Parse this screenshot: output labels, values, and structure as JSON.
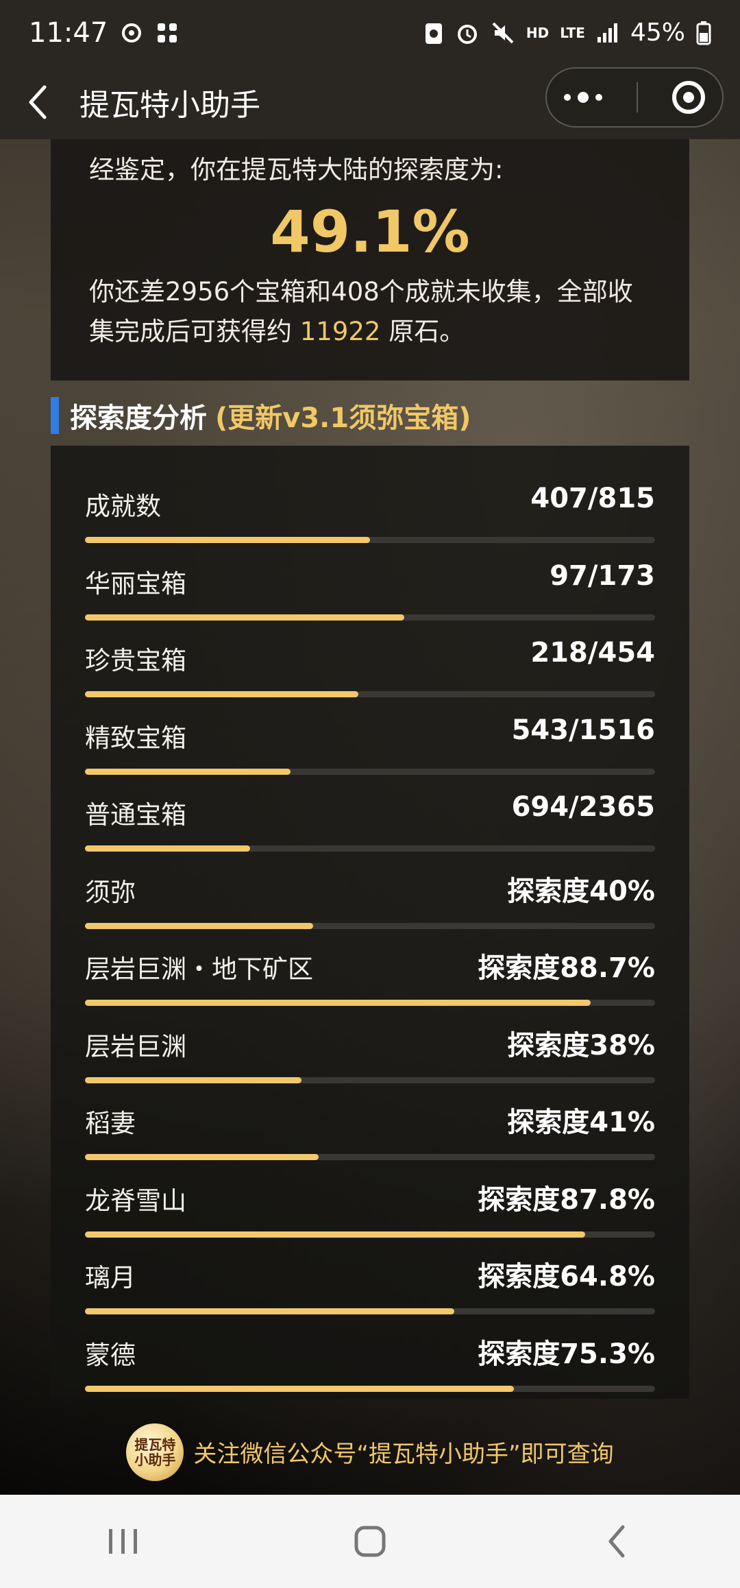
{
  "status_bar": {
    "time": "11:47",
    "battery": "45%",
    "icons": [
      "sync-icon",
      "grid-icon",
      "recycle-icon",
      "alarm-icon",
      "mute-icon",
      "hd-voice-icon",
      "lte-icon",
      "signal-icon",
      "battery-icon"
    ],
    "hd_label": "HD",
    "lte_label": "LTE"
  },
  "nav": {
    "title": "提瓦特小助手"
  },
  "summary": {
    "lead": "经鉴定，你在提瓦特大陆的探索度为:",
    "percent": "49.1%",
    "desc_prefix": "你还差2956个宝箱和408个成就未收集，全部收集完成后可获得约 ",
    "gems": "11922",
    "desc_suffix": " 原石。"
  },
  "section": {
    "title": "探索度分析",
    "subtitle": "(更新v3.1须弥宝箱)"
  },
  "stats": [
    {
      "label": "成就数",
      "value": "407/815",
      "progress": 0.5
    },
    {
      "label": "华丽宝箱",
      "value": "97/173",
      "progress": 0.56
    },
    {
      "label": "珍贵宝箱",
      "value": "218/454",
      "progress": 0.48
    },
    {
      "label": "精致宝箱",
      "value": "543/1516",
      "progress": 0.36
    },
    {
      "label": "普通宝箱",
      "value": "694/2365",
      "progress": 0.29
    },
    {
      "label": "须弥",
      "value": "探索度40%",
      "progress": 0.4
    },
    {
      "label": "层岩巨渊・地下矿区",
      "value": "探索度88.7%",
      "progress": 0.887
    },
    {
      "label": "层岩巨渊",
      "value": "探索度38%",
      "progress": 0.38
    },
    {
      "label": "稻妻",
      "value": "探索度41%",
      "progress": 0.41
    },
    {
      "label": "龙脊雪山",
      "value": "探索度87.8%",
      "progress": 0.878
    },
    {
      "label": "璃月",
      "value": "探索度64.8%",
      "progress": 0.648
    },
    {
      "label": "蒙德",
      "value": "探索度75.3%",
      "progress": 0.753
    }
  ],
  "footer": {
    "logo_text": "提瓦特小助手",
    "text": "关注微信公众号“提瓦特小助手”即可查询"
  },
  "colors": {
    "accent_gold": "#f1c866",
    "section_bar_blue": "#2f7de1",
    "progress_fill": "#f2c86a",
    "progress_track": "#3a3835"
  }
}
